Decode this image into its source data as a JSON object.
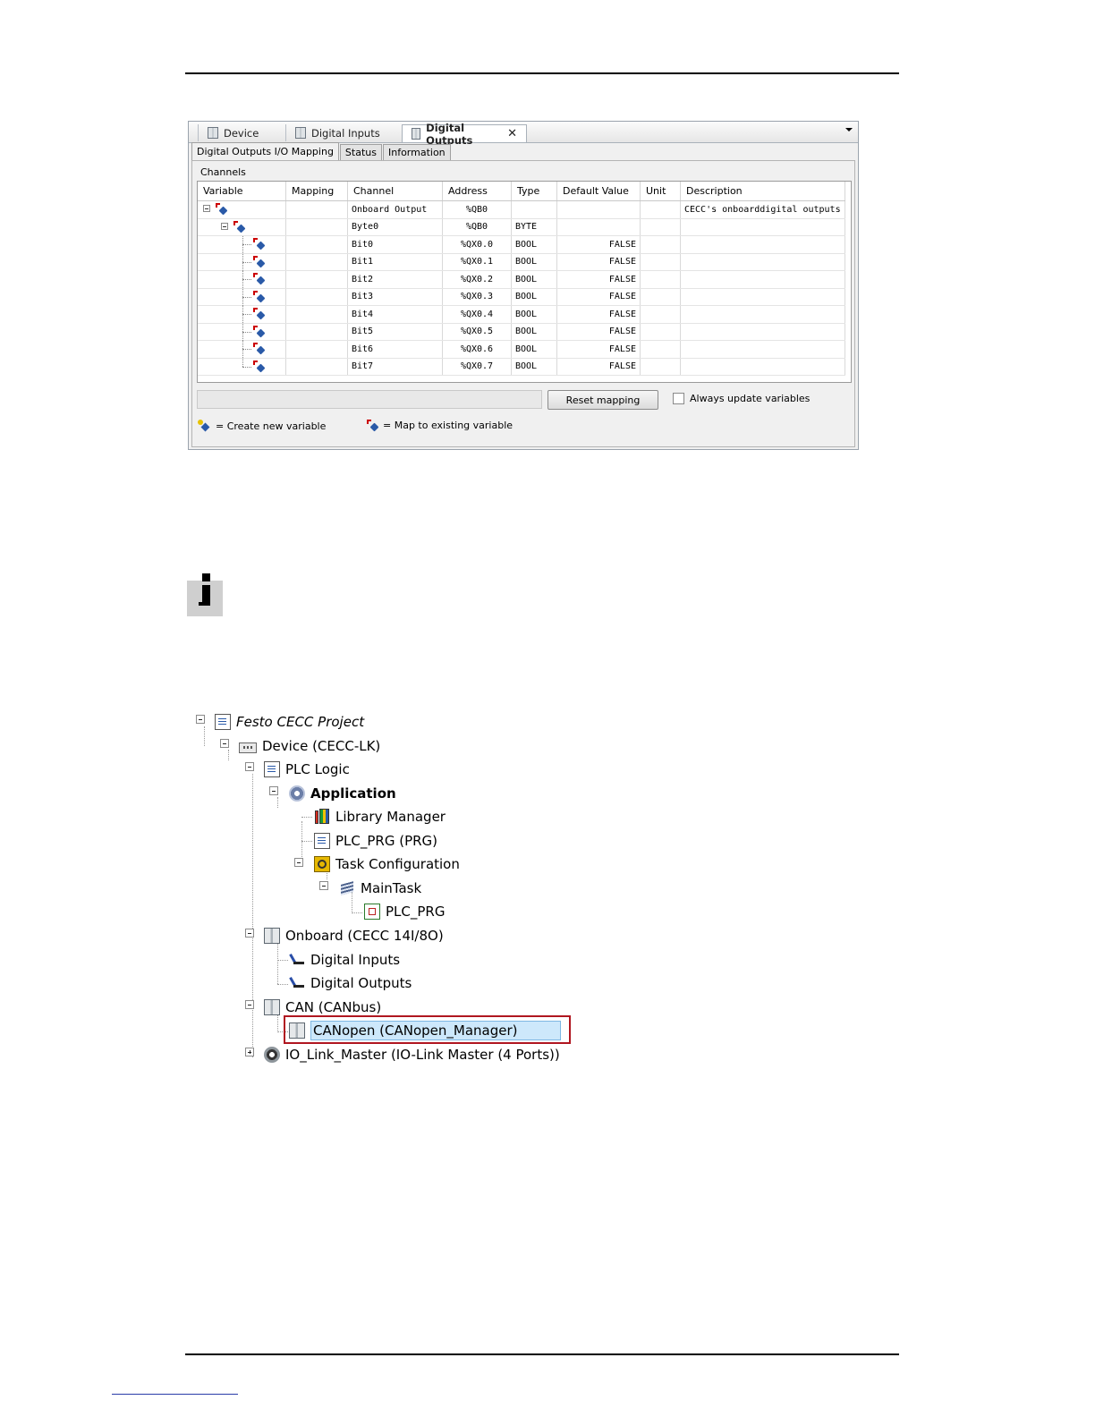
{
  "editor": {
    "tabs": [
      {
        "label": "Device"
      },
      {
        "label": "Digital Inputs"
      },
      {
        "label": "Digital Outputs",
        "active": true
      }
    ],
    "subtabs": [
      {
        "label": "Digital Outputs I/O Mapping",
        "active": true
      },
      {
        "label": "Status"
      },
      {
        "label": "Information"
      }
    ],
    "channels_title": "Channels",
    "columns": [
      "Variable",
      "Mapping",
      "Channel",
      "Address",
      "Type",
      "Default Value",
      "Unit",
      "Description"
    ],
    "rows": [
      {
        "channel": "Onboard Output",
        "address": "%QB0",
        "type": "",
        "default": "",
        "unit": "",
        "description": "CECC's onboarddigital outputs"
      },
      {
        "channel": "Byte0",
        "address": "%QB0",
        "type": "BYTE",
        "default": "",
        "unit": "",
        "description": ""
      },
      {
        "channel": "Bit0",
        "address": "%QX0.0",
        "type": "BOOL",
        "default": "FALSE",
        "unit": "",
        "description": ""
      },
      {
        "channel": "Bit1",
        "address": "%QX0.1",
        "type": "BOOL",
        "default": "FALSE",
        "unit": "",
        "description": ""
      },
      {
        "channel": "Bit2",
        "address": "%QX0.2",
        "type": "BOOL",
        "default": "FALSE",
        "unit": "",
        "description": ""
      },
      {
        "channel": "Bit3",
        "address": "%QX0.3",
        "type": "BOOL",
        "default": "FALSE",
        "unit": "",
        "description": ""
      },
      {
        "channel": "Bit4",
        "address": "%QX0.4",
        "type": "BOOL",
        "default": "FALSE",
        "unit": "",
        "description": ""
      },
      {
        "channel": "Bit5",
        "address": "%QX0.5",
        "type": "BOOL",
        "default": "FALSE",
        "unit": "",
        "description": ""
      },
      {
        "channel": "Bit6",
        "address": "%QX0.6",
        "type": "BOOL",
        "default": "FALSE",
        "unit": "",
        "description": ""
      },
      {
        "channel": "Bit7",
        "address": "%QX0.7",
        "type": "BOOL",
        "default": "FALSE",
        "unit": "",
        "description": ""
      }
    ],
    "reset_button": "Reset mapping",
    "always_update_label": "Always update variables",
    "always_update_checked": false,
    "legend_new": "= Create new variable",
    "legend_map": "= Map to existing variable"
  },
  "project_tree": {
    "nodes": [
      {
        "label": "Festo CECC Project",
        "icon": "project-icon"
      },
      {
        "label": "Device (CECC-LK)",
        "icon": "device-icon"
      },
      {
        "label": "PLC Logic",
        "icon": "plc-logic-icon"
      },
      {
        "label": "Application",
        "icon": "application-gear-icon"
      },
      {
        "label": "Library Manager",
        "icon": "library-books-icon"
      },
      {
        "label": "PLC_PRG (PRG)",
        "icon": "program-document-icon"
      },
      {
        "label": "Task Configuration",
        "icon": "task-configuration-icon"
      },
      {
        "label": "MainTask",
        "icon": "task-stack-icon"
      },
      {
        "label": "PLC_PRG",
        "icon": "program-call-icon"
      },
      {
        "label": "Onboard (CECC 14I/8O)",
        "icon": "module-icon"
      },
      {
        "label": "Digital Inputs",
        "icon": "io-channel-icon"
      },
      {
        "label": "Digital Outputs",
        "icon": "io-channel-icon"
      },
      {
        "label": "CAN (CANbus)",
        "icon": "module-icon"
      },
      {
        "label": "CANopen (CANopen_Manager)",
        "icon": "module-icon",
        "selected": true
      },
      {
        "label": "IO_Link_Master (IO-Link Master (4 Ports))",
        "icon": "iolink-icon"
      }
    ]
  },
  "colors": {
    "selection_fill": "#cde8fb",
    "highlight_frame": "#b01620",
    "info_box": "#cfcfcf"
  }
}
